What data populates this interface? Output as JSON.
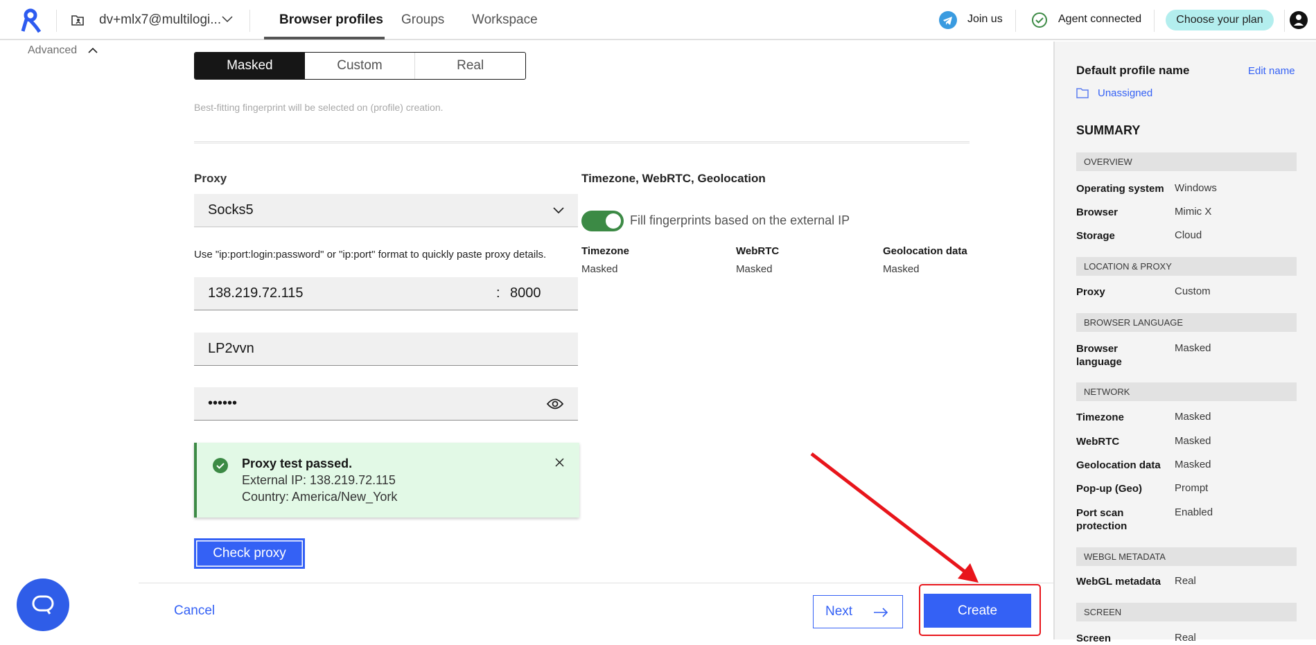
{
  "header": {
    "account": "dv+mlx7@multilogi...",
    "tabs": [
      "Browser profiles",
      "Groups",
      "Workspace"
    ],
    "join_us": "Join us",
    "agent_status": "Agent connected",
    "plan_button": "Choose your plan"
  },
  "advanced": {
    "label": "Advanced"
  },
  "fingerprint": {
    "options": [
      "Masked",
      "Custom",
      "Real"
    ],
    "selected": "Masked",
    "hint": "Best-fitting fingerprint will be selected on (profile) creation."
  },
  "proxy": {
    "label": "Proxy",
    "type": "Socks5",
    "help": "Use \"ip:port:login:password\" or \"ip:port\" format to quickly paste proxy details.",
    "host": "138.219.72.115",
    "colon": ":",
    "port": "8000",
    "login": "LP2vvn",
    "password": "••••••",
    "check_button": "Check proxy"
  },
  "notification": {
    "title": "Proxy test passed.",
    "line1": "External IP: 138.219.72.115",
    "line2": "Country: America/New_York",
    "status_color": "#24a148"
  },
  "geo": {
    "title": "Timezone, WebRTC, Geolocation",
    "toggle_label": "Fill fingerprints based on the external IP",
    "toggle_on": true,
    "columns": [
      {
        "label": "Timezone",
        "value": "Masked"
      },
      {
        "label": "WebRTC",
        "value": "Masked"
      },
      {
        "label": "Geolocation data",
        "value": "Masked"
      }
    ]
  },
  "footer": {
    "cancel": "Cancel",
    "next": "Next",
    "create": "Create"
  },
  "sidebar": {
    "profile_name": "Default profile name",
    "edit_name": "Edit name",
    "folder": "Unassigned",
    "summary": "SUMMARY",
    "sections": {
      "overview": "OVERVIEW",
      "location": "LOCATION & PROXY",
      "language": "BROWSER LANGUAGE",
      "network": "NETWORK",
      "webgl": "WEBGL METADATA",
      "screen": "SCREEN"
    },
    "rows": {
      "os": [
        "Operating system",
        "Windows"
      ],
      "browser": [
        "Browser",
        "Mimic X"
      ],
      "storage": [
        "Storage",
        "Cloud"
      ],
      "proxy": [
        "Proxy",
        "Custom"
      ],
      "language": [
        "Browser language",
        "Masked"
      ],
      "timezone": [
        "Timezone",
        "Masked"
      ],
      "webrtc": [
        "WebRTC",
        "Masked"
      ],
      "geo": [
        "Geolocation data",
        "Masked"
      ],
      "popup": [
        "Pop-up (Geo)",
        "Prompt"
      ],
      "portscan": [
        "Port scan protection",
        "Enabled"
      ],
      "webgl": [
        "WebGL metadata",
        "Real"
      ],
      "screen": [
        "Screen",
        "Real"
      ]
    }
  },
  "colors": {
    "accent": "#3461f5",
    "plan": "#b3eeee",
    "annotation": "#e8151b"
  }
}
